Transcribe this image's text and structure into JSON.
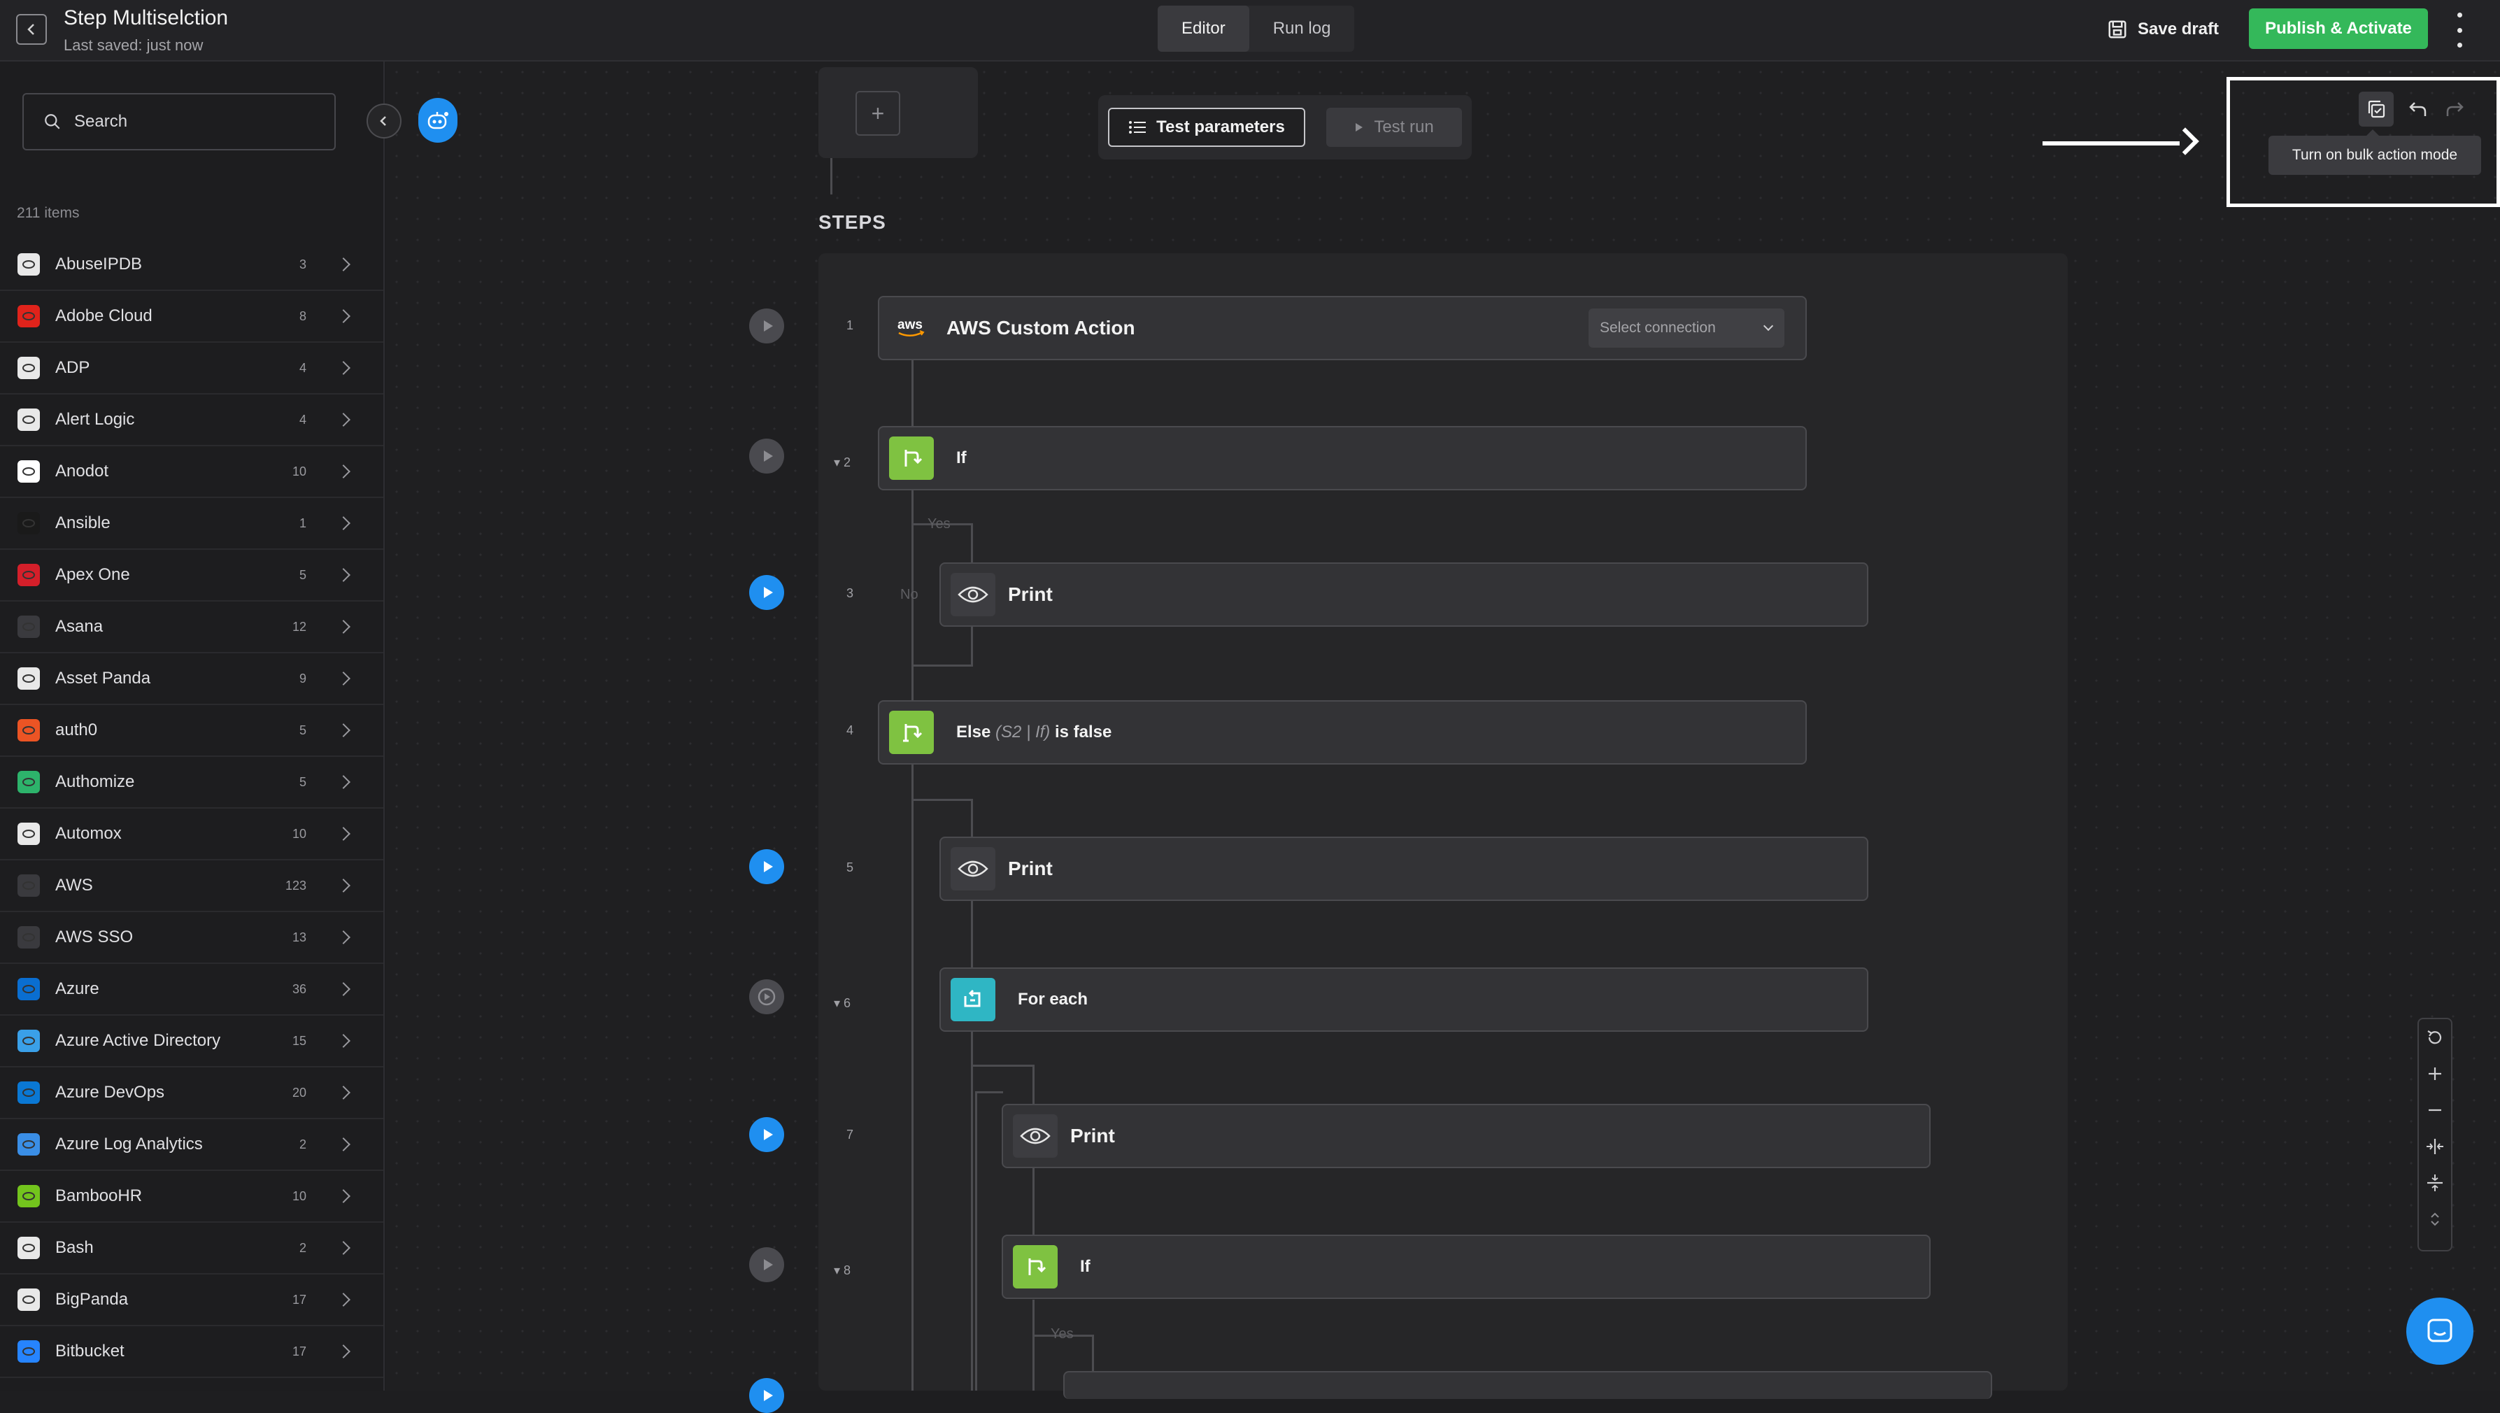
{
  "header": {
    "back_icon": "chevron-left-icon",
    "title": "Step Multiselction",
    "saved": "Last saved: just now",
    "tabs": [
      {
        "label": "Editor",
        "active": true
      },
      {
        "label": "Run log",
        "active": false
      }
    ],
    "save_draft": "Save draft",
    "publish": "Publish & Activate",
    "menu_icon": "kebab-menu-icon",
    "publish_color": "#34b85a"
  },
  "sidebar": {
    "search_placeholder": "Search",
    "items_count": "211 items",
    "items": [
      {
        "name": "AbuseIPDB",
        "count": "3",
        "icon": "abuseipdb-icon",
        "color": "#e8e8e8"
      },
      {
        "name": "Adobe Cloud",
        "count": "8",
        "icon": "adobe-icon",
        "color": "#e0231b"
      },
      {
        "name": "ADP",
        "count": "4",
        "icon": "adp-icon",
        "color": "#e8e8e8"
      },
      {
        "name": "Alert Logic",
        "count": "4",
        "icon": "alert-logic-icon",
        "color": "#e8e8e8"
      },
      {
        "name": "Anodot",
        "count": "10",
        "icon": "anodot-icon",
        "color": "#ffffff"
      },
      {
        "name": "Ansible",
        "count": "1",
        "icon": "ansible-icon",
        "color": "#1a1a1a"
      },
      {
        "name": "Apex One",
        "count": "5",
        "icon": "apex-one-icon",
        "color": "#d41f2a"
      },
      {
        "name": "Asana",
        "count": "12",
        "icon": "asana-icon",
        "color": "#3a3a3e"
      },
      {
        "name": "Asset Panda",
        "count": "9",
        "icon": "asset-panda-icon",
        "color": "#e8e8e8"
      },
      {
        "name": "auth0",
        "count": "5",
        "icon": "auth0-icon",
        "color": "#eb5424"
      },
      {
        "name": "Authomize",
        "count": "5",
        "icon": "authomize-icon",
        "color": "#2db36b"
      },
      {
        "name": "Automox",
        "count": "10",
        "icon": "automox-icon",
        "color": "#e8e8e8"
      },
      {
        "name": "AWS",
        "count": "123",
        "icon": "aws-icon",
        "color": "#3a3a3e"
      },
      {
        "name": "AWS SSO",
        "count": "13",
        "icon": "aws-sso-icon",
        "color": "#3a3a3e"
      },
      {
        "name": "Azure",
        "count": "36",
        "icon": "azure-icon",
        "color": "#0a6ed1"
      },
      {
        "name": "Azure Active Directory",
        "count": "15",
        "icon": "azure-ad-icon",
        "color": "#3aa0e8"
      },
      {
        "name": "Azure DevOps",
        "count": "20",
        "icon": "azure-devops-icon",
        "color": "#0a78d4"
      },
      {
        "name": "Azure Log Analytics",
        "count": "2",
        "icon": "azure-log-analytics-icon",
        "color": "#3a8ee6"
      },
      {
        "name": "BambooHR",
        "count": "10",
        "icon": "bamboohr-icon",
        "color": "#73c41d"
      },
      {
        "name": "Bash",
        "count": "2",
        "icon": "bash-icon",
        "color": "#e8e8e8"
      },
      {
        "name": "BigPanda",
        "count": "17",
        "icon": "bigpanda-icon",
        "color": "#e8e8e8"
      },
      {
        "name": "Bitbucket",
        "count": "17",
        "icon": "bitbucket-icon",
        "color": "#2684ff"
      }
    ]
  },
  "canvas": {
    "start_plus": "+",
    "test_parameters": "Test parameters",
    "test_run": "Test run",
    "steps_label": "STEPS",
    "steps": [
      {
        "num": "1",
        "title": "AWS Custom Action",
        "icon": "aws-logo-icon",
        "connection_placeholder": "Select connection"
      },
      {
        "num": "2",
        "title": "If",
        "icon": "branch-icon"
      },
      {
        "num": "3",
        "title": "Print",
        "icon": "eye-icon"
      },
      {
        "num": "4",
        "title": "Else",
        "subtitle": "(S2 | If)",
        "suffix": "is false",
        "icon": "branch-icon"
      },
      {
        "num": "5",
        "title": "Print",
        "icon": "eye-icon"
      },
      {
        "num": "6",
        "title": "For each",
        "icon": "loop-icon"
      },
      {
        "num": "7",
        "title": "Print",
        "icon": "eye-icon"
      },
      {
        "num": "8",
        "title": "If",
        "icon": "branch-icon"
      }
    ],
    "branch_yes": "Yes",
    "branch_no": "No",
    "bulk_tooltip": "Turn on bulk action mode",
    "chat_icon": "chat-icon"
  }
}
